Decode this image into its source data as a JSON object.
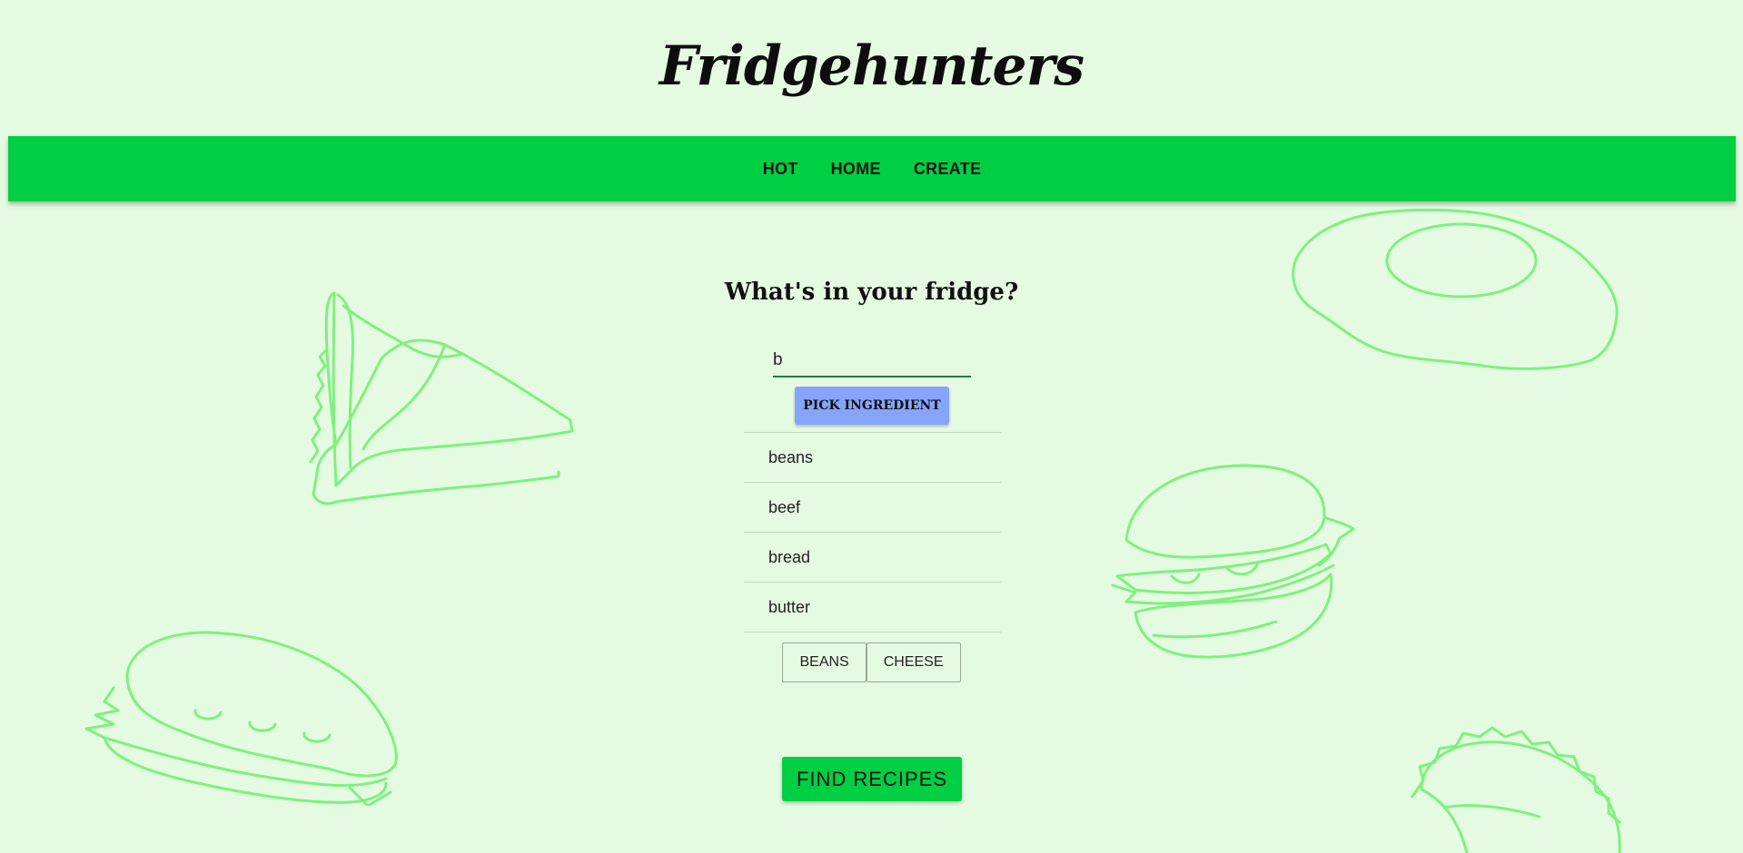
{
  "app": {
    "title": "Fridgehunters"
  },
  "nav": {
    "items": [
      {
        "label": "HOT"
      },
      {
        "label": "HOME"
      },
      {
        "label": "CREATE"
      }
    ]
  },
  "main": {
    "heading": "What's in your fridge?",
    "search": {
      "value": "b",
      "placeholder": ""
    },
    "pick_button_label": "PICK INGREDIENT",
    "suggestions": [
      {
        "label": "beans"
      },
      {
        "label": "beef"
      },
      {
        "label": "bread"
      },
      {
        "label": "butter"
      }
    ],
    "selected": [
      {
        "label": "BEANS"
      },
      {
        "label": "CHEESE"
      }
    ],
    "find_button_label": "FIND RECIPES"
  },
  "colors": {
    "background": "#e5fbe1",
    "nav_bar": "#00cf43",
    "pick_button": "#86a4fb",
    "find_button": "#00cf43",
    "doodle_stroke": "#7ff07f"
  },
  "icons": [
    "pie-slice-doodle",
    "fried-egg-doodle",
    "burger-doodle",
    "sub-sandwich-doodle",
    "taco-doodle"
  ]
}
